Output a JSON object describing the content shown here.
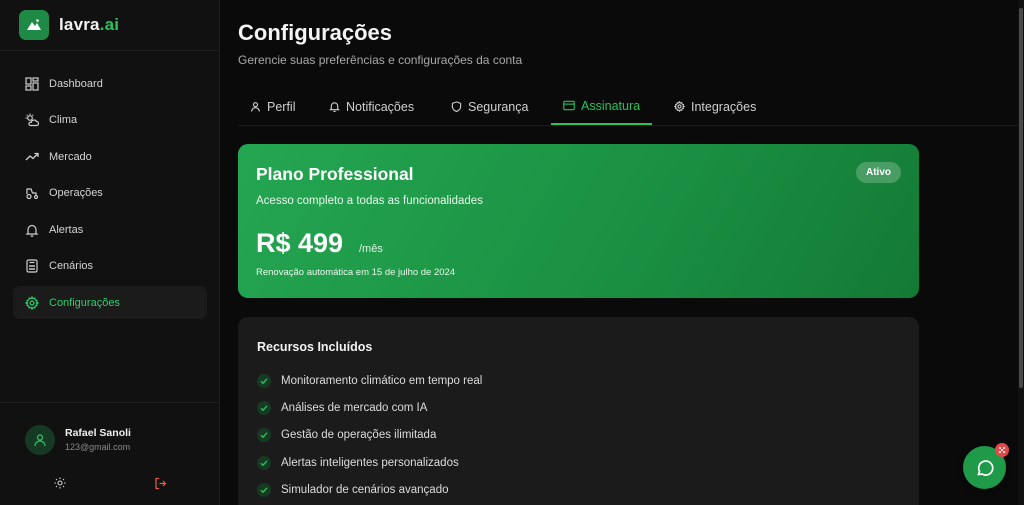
{
  "brand": {
    "name": "lavra",
    "suffix": ".ai"
  },
  "sidebar": {
    "items": [
      {
        "label": "Dashboard",
        "icon": "dashboard-icon"
      },
      {
        "label": "Clima",
        "icon": "weather-icon"
      },
      {
        "label": "Mercado",
        "icon": "trending-up-icon"
      },
      {
        "label": "Operações",
        "icon": "tractor-icon"
      },
      {
        "label": "Alertas",
        "icon": "bell-icon"
      },
      {
        "label": "Cenários",
        "icon": "calculator-icon"
      },
      {
        "label": "Configurações",
        "icon": "gear-icon",
        "active": true
      }
    ]
  },
  "user": {
    "name": "Rafael Sanoli",
    "email": "123@gmail.com"
  },
  "header": {
    "title": "Configurações",
    "subtitle": "Gerencie suas preferências e configurações da conta"
  },
  "tabs": [
    {
      "label": "Perfil",
      "icon": "user-icon"
    },
    {
      "label": "Notificações",
      "icon": "bell-icon"
    },
    {
      "label": "Segurança",
      "icon": "shield-icon"
    },
    {
      "label": "Assinatura",
      "icon": "credit-card-icon",
      "active": true
    },
    {
      "label": "Integrações",
      "icon": "gear-icon"
    }
  ],
  "plan": {
    "name": "Plano Professional",
    "description": "Acesso completo a todas as funcionalidades",
    "price": "R$ 499",
    "period": "/mês",
    "renewal": "Renovação automática em 15 de julho de 2024",
    "status": "Ativo"
  },
  "features": {
    "title": "Recursos Incluídos",
    "items": [
      "Monitoramento climático em tempo real",
      "Análises de mercado com IA",
      "Gestão de operações ilimitada",
      "Alertas inteligentes personalizados",
      "Simulador de cenários avançado"
    ]
  },
  "colors": {
    "accent": "#27c25d",
    "background": "#0a0a0a",
    "card": "#1b1b1b",
    "plan_green": "#1b9143"
  }
}
